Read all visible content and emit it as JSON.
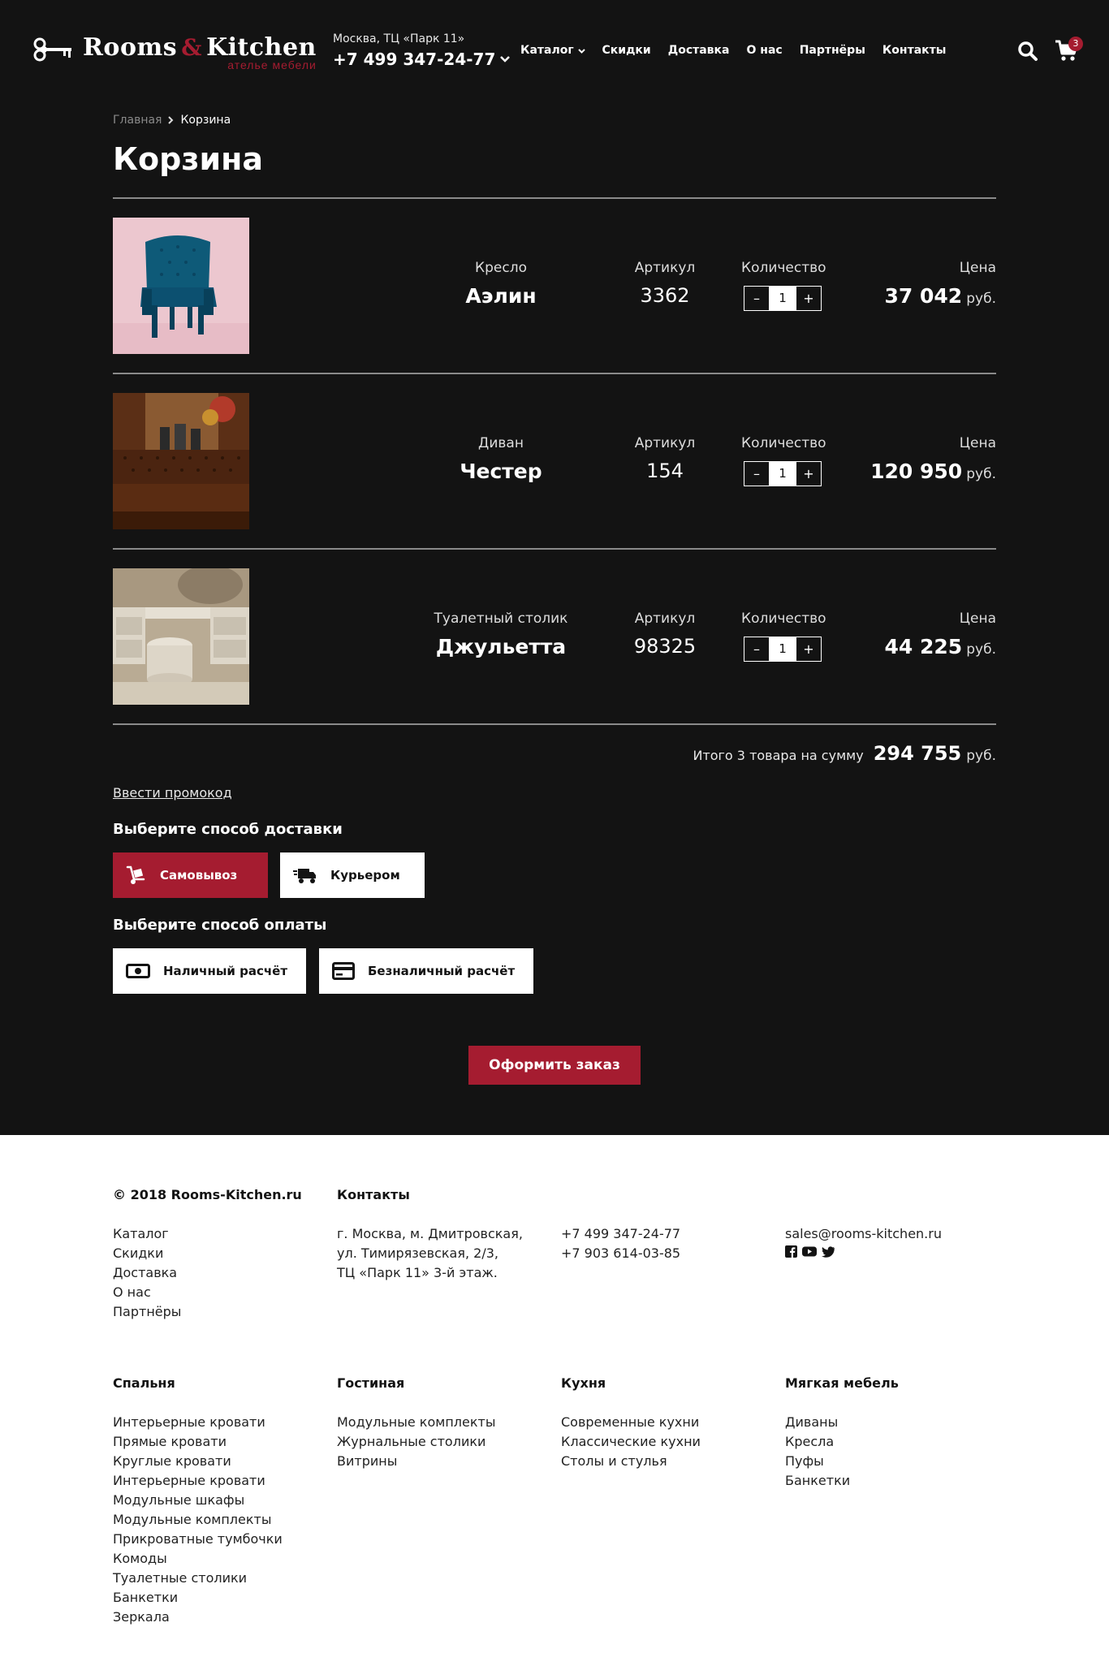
{
  "header": {
    "logo_main_1": "Rooms",
    "logo_amp": "&",
    "logo_main_2": "Kitchen",
    "logo_sub": "ателье мебели",
    "location": "Москва, ТЦ «Парк 11»",
    "phone": "+7 499 347-24-77",
    "nav": [
      "Каталог",
      "Скидки",
      "Доставка",
      "О нас",
      "Партнёры",
      "Контакты"
    ],
    "cart_count": "3"
  },
  "breadcrumb": {
    "home": "Главная",
    "current": "Корзина"
  },
  "page_title": "Корзина",
  "labels": {
    "article": "Артикул",
    "quantity": "Количество",
    "price": "Цена",
    "currency": "руб."
  },
  "items": [
    {
      "category": "Кресло",
      "name": "Аэлин",
      "article": "3362",
      "qty": "1",
      "price": "37 042"
    },
    {
      "category": "Диван",
      "name": "Честер",
      "article": "154",
      "qty": "1",
      "price": "120 950"
    },
    {
      "category": "Туалетный столик",
      "name": "Джульетта",
      "article": "98325",
      "qty": "1",
      "price": "44 225"
    }
  ],
  "total": {
    "text": "Итого 3 товара на сумму",
    "sum": "294 755",
    "currency": "руб."
  },
  "promo_link": "Ввести промокод",
  "delivery": {
    "title": "Выберите способ доставки",
    "options": [
      "Самовывоз",
      "Курьером"
    ],
    "selected": "Самовывоз"
  },
  "payment": {
    "title": "Выберите способ оплаты",
    "options": [
      "Наличный расчёт",
      "Безналичный расчёт"
    ]
  },
  "order_button": "Оформить заказ",
  "footer": {
    "copyright": "© 2018 Rooms-Kitchen.ru",
    "contacts_title": "Контакты",
    "menu": [
      "Каталог",
      "Скидки",
      "Доставка",
      "О нас",
      "Партнёры"
    ],
    "address": [
      "г. Москва, м. Дмитровская,",
      "ул. Тимирязевская, 2/3,",
      "ТЦ «Парк 11» 3-й этаж."
    ],
    "phones": [
      "+7 499 347-24-77",
      "+7 903 614-03-85"
    ],
    "email": "sales@rooms-kitchen.ru",
    "categories": [
      {
        "title": "Спальня",
        "items": [
          "Интерьерные кровати",
          "Прямые кровати",
          "Круглые кровати",
          "Интерьерные кровати",
          "Модульные шкафы",
          "Модульные комплекты",
          "Прикроватные тумбочки",
          "Комоды",
          "Туалетные столики",
          "Банкетки",
          "Зеркала"
        ]
      },
      {
        "title": "Гостиная",
        "items": [
          "Модульные комплекты",
          "Журнальные столики",
          "Витрины"
        ]
      },
      {
        "title": "Кухня",
        "items": [
          "Современные кухни",
          "Классические кухни",
          "Столы и стулья"
        ]
      },
      {
        "title": "Мягкая мебель",
        "items": [
          "Диваны",
          "Кресла",
          "Пуфы",
          "Банкетки"
        ]
      }
    ]
  },
  "colors": {
    "background": "#131313",
    "accent": "#a51c30",
    "footer_bg": "#ffffff"
  }
}
